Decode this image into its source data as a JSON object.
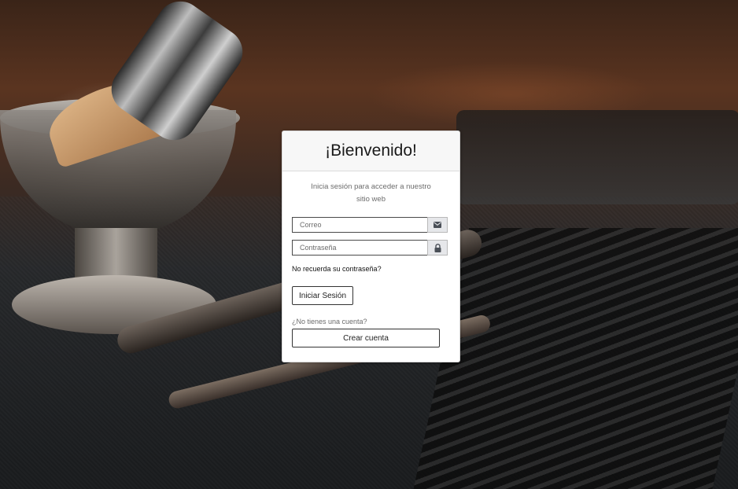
{
  "background": {
    "description_icon": "barber-tools-photo"
  },
  "login_card": {
    "title": "¡Bienvenido!",
    "subtitle": "Inicia sesión para acceder a nuestro sitio web",
    "email": {
      "placeholder": "Correo",
      "value": "",
      "icon": "envelope-icon"
    },
    "password": {
      "placeholder": "Contraseña",
      "value": "",
      "icon": "lock-icon"
    },
    "forgot_password_label": "No recuerda su contraseña?",
    "login_button_label": "Iniciar Sesión",
    "no_account_label": "¿No tienes una cuenta?",
    "register_button_label": "Crear cuenta"
  },
  "colors": {
    "card_header_bg": "#f7f7f7",
    "addon_bg": "#e6e7ea",
    "icon_color": "#4a4f57"
  }
}
